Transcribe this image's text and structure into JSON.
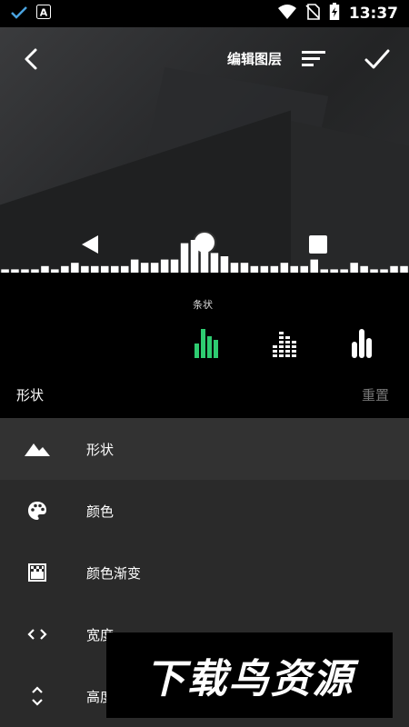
{
  "status_bar": {
    "time": "13:37",
    "left_icons": [
      "check-icon",
      "app-a-icon"
    ],
    "right_icons": [
      "wifi-icon",
      "no-sim-icon",
      "battery-icon"
    ]
  },
  "header": {
    "title": "编辑图层",
    "back_icon": "chevron-left-icon",
    "sort_icon": "sort-icon",
    "confirm_icon": "checkmark-icon"
  },
  "playback": {
    "prev_icon": "prev-triangle-icon",
    "play_icon": "circle-icon",
    "stop_icon": "square-icon"
  },
  "visualizer": {
    "levels": [
      0.1,
      0.1,
      0.1,
      0.1,
      0.2,
      0.1,
      0.2,
      0.3,
      0.2,
      0.2,
      0.2,
      0.2,
      0.2,
      0.4,
      0.3,
      0.3,
      0.4,
      0.4,
      0.9,
      1.0,
      0.8,
      0.6,
      0.5,
      0.3,
      0.3,
      0.2,
      0.2,
      0.2,
      0.3,
      0.2,
      0.2,
      0.4,
      0.1,
      0.1,
      0.1,
      0.3,
      0.2,
      0.1,
      0.1,
      0.2,
      0.2
    ]
  },
  "shape_panel": {
    "selected_label": "条状",
    "options": [
      {
        "name": "bars-solid",
        "selected": true
      },
      {
        "name": "bars-segmented",
        "selected": false
      },
      {
        "name": "bars-rounded",
        "selected": false
      }
    ],
    "section_title": "形状",
    "reset": "重置"
  },
  "colors": {
    "accent": "#2ecc71",
    "list_bg": "#2a2a2a",
    "list_selected": "#323232"
  },
  "menu": {
    "items": [
      {
        "label": "形状",
        "icon": "mountain-icon",
        "selected": true
      },
      {
        "label": "颜色",
        "icon": "palette-icon",
        "selected": false
      },
      {
        "label": "颜色渐变",
        "icon": "gradient-icon",
        "selected": false
      },
      {
        "label": "宽度",
        "icon": "code-brackets-icon",
        "selected": false
      },
      {
        "label": "高度",
        "icon": "vertical-arrows-icon",
        "selected": false
      }
    ]
  },
  "watermark": {
    "text": "下载鸟资源"
  }
}
